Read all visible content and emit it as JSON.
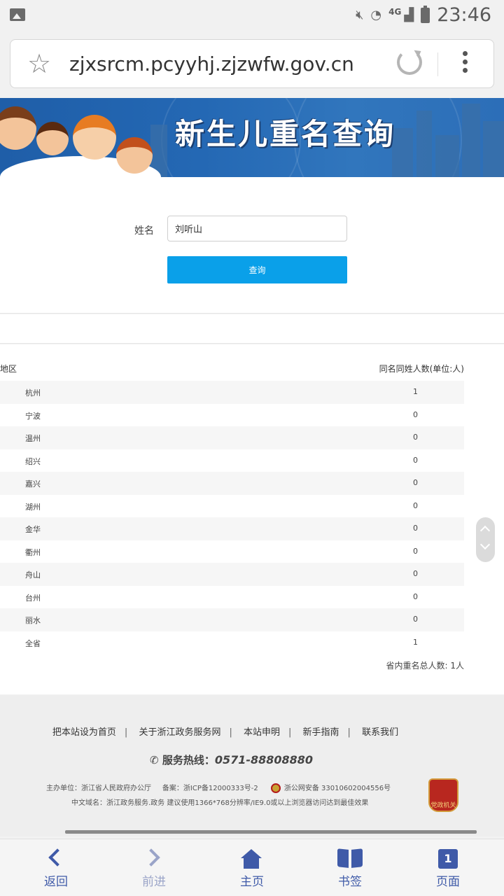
{
  "statusbar": {
    "network": "4G",
    "time": "23:46"
  },
  "browser": {
    "url": "zjxsrcm.pcyyhj.zjzwfw.gov.cn"
  },
  "banner": {
    "title": "新生儿重名查询"
  },
  "form": {
    "name_label": "姓名",
    "name_value": "刘听山",
    "query_label": "查询"
  },
  "table": {
    "col1": "地区",
    "col2": "同名同姓人数(单位:人)",
    "rows": [
      {
        "city": "杭州",
        "count": "1"
      },
      {
        "city": "宁波",
        "count": "0"
      },
      {
        "city": "温州",
        "count": "0"
      },
      {
        "city": "绍兴",
        "count": "0"
      },
      {
        "city": "嘉兴",
        "count": "0"
      },
      {
        "city": "湖州",
        "count": "0"
      },
      {
        "city": "金华",
        "count": "0"
      },
      {
        "city": "衢州",
        "count": "0"
      },
      {
        "city": "舟山",
        "count": "0"
      },
      {
        "city": "台州",
        "count": "0"
      },
      {
        "city": "丽水",
        "count": "0"
      },
      {
        "city": "全省",
        "count": "1"
      }
    ],
    "total": "省内重名总人数: 1人"
  },
  "footer": {
    "links": [
      "把本站设为首页",
      "关于浙江政务服务网",
      "本站申明",
      "新手指南",
      "联系我们"
    ],
    "hotline_label": "服务热线：",
    "hotline_number": "0571-88808880",
    "info_sponsor": "主办单位：浙江省人民政府办公厅",
    "info_icp": "备案：浙ICP备12000333号-2",
    "info_police": "浙公网安备 33010602004556号",
    "info_domain": "中文域名：浙江政务服务.政务 建议使用1366*768分辨率/IE9.0或以上浏览器访问达到最佳效果",
    "badge_text": "党政机关"
  },
  "bottombar": {
    "back": "返回",
    "forward": "前进",
    "home": "主页",
    "bookmarks": "书签",
    "pages": "页面",
    "page_count": "1"
  },
  "colors": {
    "accent": "#0aa0e9",
    "nav": "#3f5aa8"
  }
}
